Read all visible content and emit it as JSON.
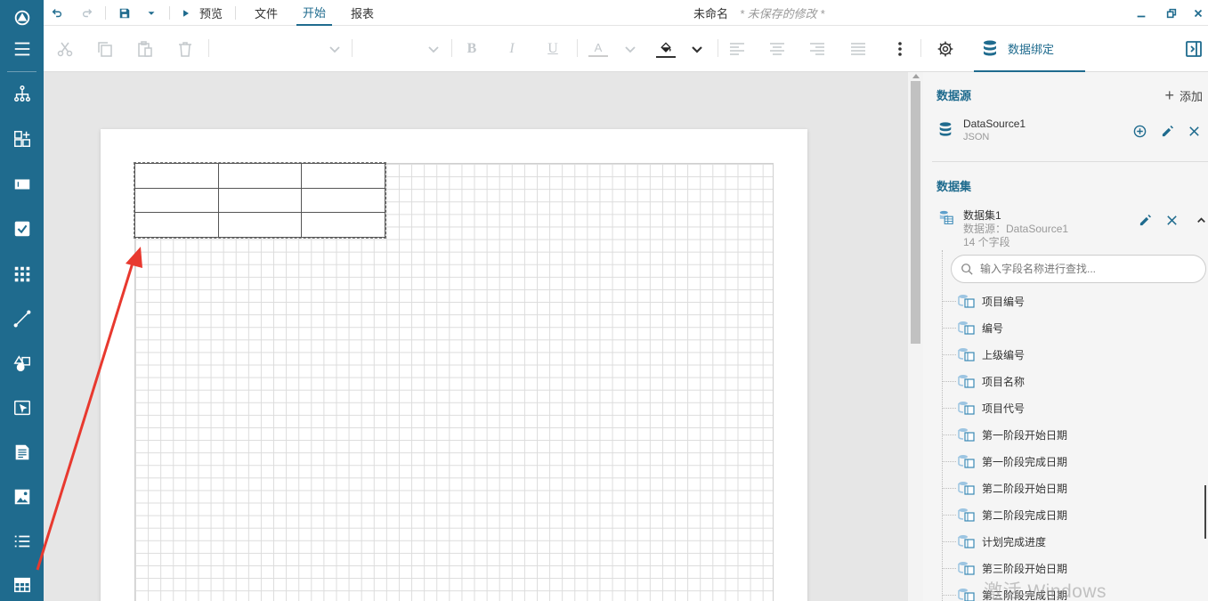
{
  "topbar": {
    "preview_label": "预览",
    "menus": [
      "文件",
      "开始",
      "报表"
    ],
    "active_menu": "开始",
    "doc_title": "未命名",
    "doc_status": "* 未保存的修改 *"
  },
  "ribbon": {
    "bold_label": "B",
    "italic_label": "I",
    "underline_label": "U",
    "font_color_label": "A",
    "binding_tab_label": "数据绑定"
  },
  "sidebar": {
    "icons": [
      "logo-icon",
      "menu-icon",
      "hierarchy-icon",
      "layout-icon",
      "textbox-icon",
      "checkbox-icon",
      "matrix-icon",
      "line-icon",
      "shapes-icon",
      "select-icon",
      "richtext-icon",
      "image-icon",
      "list-icon",
      "table-icon"
    ]
  },
  "datasource": {
    "section_title": "数据源",
    "add_label": "添加",
    "name": "DataSource1",
    "type": "JSON"
  },
  "dataset": {
    "section_title": "数据集",
    "name": "数据集1",
    "source": "数据源：DataSource1",
    "count": "14 个字段",
    "search_placeholder": "输入字段名称进行查找...",
    "fields": [
      "项目编号",
      "编号",
      "上级编号",
      "项目名称",
      "项目代号",
      "第一阶段开始日期",
      "第一阶段完成日期",
      "第二阶段开始日期",
      "第二阶段完成日期",
      "计划完成进度",
      "第三阶段开始日期",
      "第三阶段完成日期"
    ]
  },
  "watermark": "激活 Windows",
  "colors": {
    "accent": "#1f6b8e",
    "arrow": "#e8392f"
  }
}
